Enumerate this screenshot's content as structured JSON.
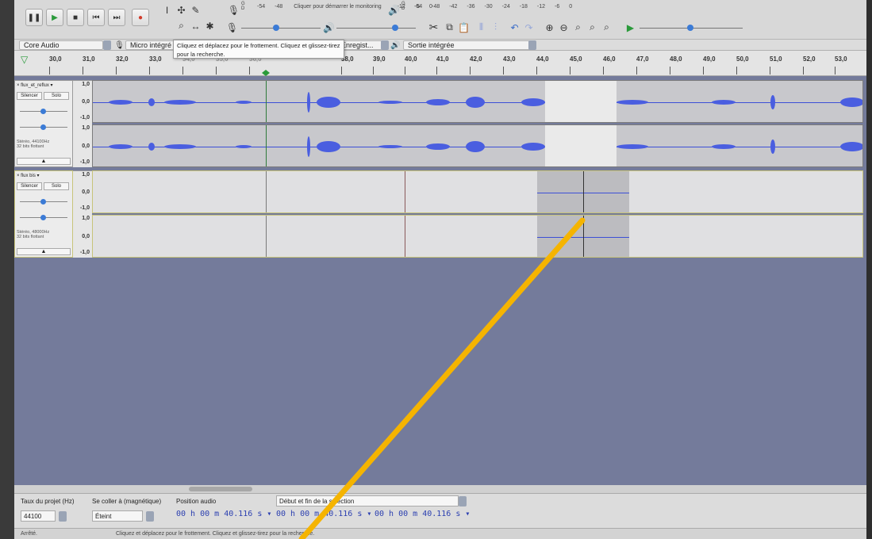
{
  "toolbar": {
    "transport": {
      "pause_icon": "pause-icon",
      "play_icon": "play-icon",
      "stop_icon": "stop-icon",
      "skip_start_icon": "skip-start-icon",
      "skip_end_icon": "skip-end-icon",
      "record_icon": "record-icon"
    },
    "record_meter_ticks": [
      "-54",
      "-48"
    ],
    "record_meter_prompt": "Cliquer pour démarrer le monitoring",
    "record_meter_ticks_right": [
      "-12",
      "-6",
      "0"
    ],
    "play_meter_ticks": [
      "-54",
      "-48",
      "-42",
      "-36",
      "-30",
      "-24",
      "-18",
      "-12",
      "-6",
      "0"
    ],
    "meter_channel_labels": [
      "G",
      "D"
    ]
  },
  "devices": {
    "host": "Core Audio",
    "input": "Micro intégré",
    "channels": "Enregist...",
    "output": "Sortie intégrée"
  },
  "tooltip": {
    "text": "Cliquez et déplacez pour le frottement. Cliquez et glissez-tirez pour la recherche."
  },
  "ruler": {
    "ticks": [
      "30,0",
      "31,0",
      "32,0",
      "33,0",
      "34,0",
      "35,0",
      "36,0",
      "38,0",
      "39,0",
      "40,0",
      "41,0",
      "42,0",
      "43,0",
      "44,0",
      "45,0",
      "46,0",
      "47,0",
      "48,0",
      "49,0",
      "50,0",
      "51,0",
      "52,0",
      "53,0"
    ]
  },
  "tracks": [
    {
      "name": "flux_et_reflux",
      "mute": "Silencer",
      "solo": "Solo",
      "info": "Stéréo, 44100Hz\n32 bits flottant",
      "scale": [
        "1,0",
        "0,0",
        "-1,0"
      ]
    },
    {
      "name": "flux bis",
      "mute": "Silencer",
      "solo": "Solo",
      "info": "Stéréo, 48000Hz\n32 bits flottant",
      "scale": [
        "1,0",
        "0,0",
        "-1,0"
      ]
    }
  ],
  "selection_toolbar": {
    "rate_label": "Taux du projet (Hz)",
    "rate_value": "44100",
    "snap_label": "Se coller à (magnétique)",
    "snap_value": "Éteint",
    "position_label": "Position audio",
    "position_value": "00 h 00 m 40.116 s",
    "selection_mode": "Début et fin de la sélection",
    "sel_start": "00 h 00 m 40.116 s",
    "sel_end": "00 h 00 m 40.116 s"
  },
  "status": {
    "state": "Arrêté.",
    "message": "Cliquez et déplacez pour le frottement. Cliquez et glissez-tirez pour la recherche."
  },
  "annotation_color": "#f5b400"
}
